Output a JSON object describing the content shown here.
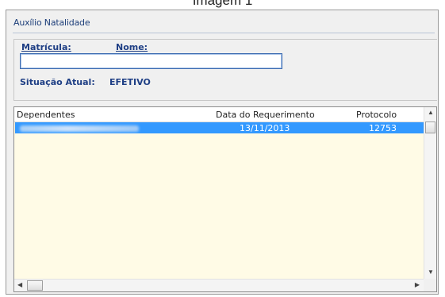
{
  "caption": "Imagem 1",
  "window": {
    "title": "Auxílio Natalidade"
  },
  "form": {
    "matricula_label": "Matrícula:",
    "nome_label": "Nome:",
    "matricula_value": "",
    "situacao_label": "Situação Atual:",
    "situacao_value": "EFETIVO"
  },
  "list": {
    "columns": [
      "Dependentes",
      "Data do Requerimento",
      "Protocolo"
    ],
    "rows": [
      {
        "dependente": "",
        "data": "13/11/2013",
        "protocolo": "12753"
      }
    ]
  },
  "icons": {
    "scroll_up": "triangle-up",
    "scroll_down": "triangle-down",
    "scroll_left": "triangle-left",
    "scroll_right": "triangle-right"
  },
  "colors": {
    "label_blue": "#1f3f85",
    "selection": "#3399ff",
    "list_background": "#fffbe6"
  }
}
